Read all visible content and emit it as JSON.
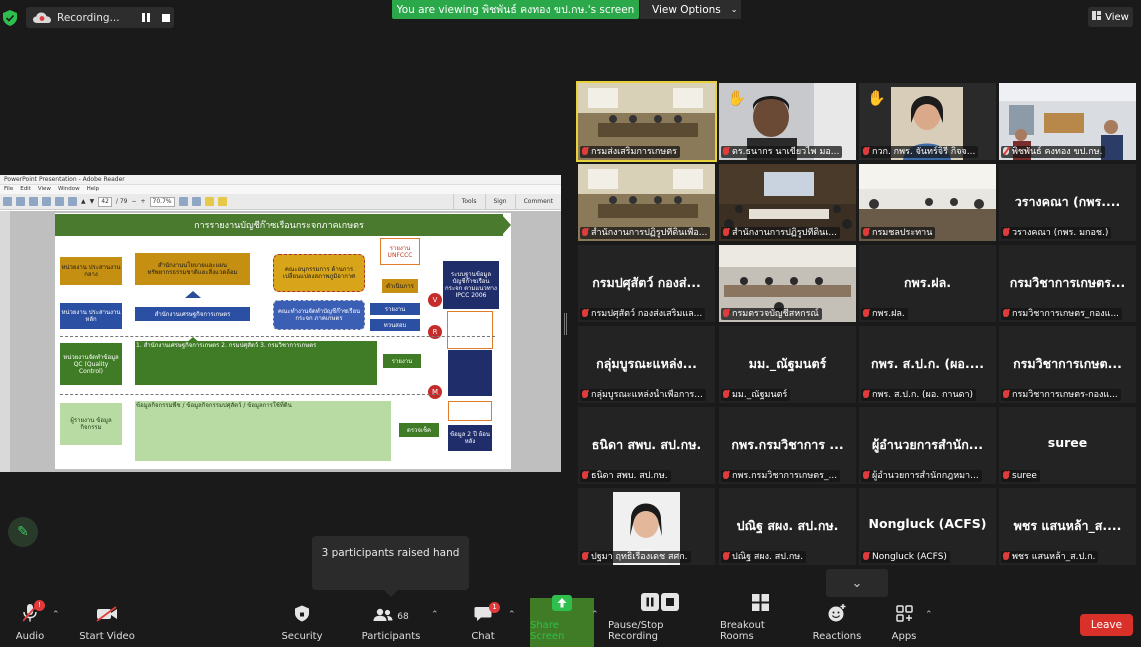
{
  "top": {
    "recording_label": "Recording...",
    "viewing_label": "You are viewing พิชพันธ์ คงทอง ขป.กษ.'s screen",
    "view_options_label": "View Options",
    "view_label": "View"
  },
  "share": {
    "window_title": "PowerPoint Presentation - Adobe Reader",
    "menu": [
      "File",
      "Edit",
      "View",
      "Window",
      "Help"
    ],
    "page_field": "42",
    "page_total": "/ 79",
    "zoom": "70.7%",
    "tools_label": "Tools",
    "sign_label": "Sign",
    "comment_label": "Comment",
    "slide": {
      "title": "การรายงานบัญชีก๊าซเรือนกระจกภาคเกษตร",
      "box_agency": "หน่วยงาน\nประสานงานกลาง",
      "box_oae": "สำนักงานนโยบายและแผน\nทรัพยากรธรรมชาติและสิ่งแวดล้อม",
      "box_subcommittee": "คณะอนุกรรมการ\nด้านการเปลี่ยนแปลงสภาพภูมิอากาศ",
      "box_unfccc_report": "รายงาน\nUNFCCC",
      "box_process": "ดำเนินการ",
      "box_ipcc": "ระบบฐานข้อมูล\nบัญชีก๊าซเรือนกระจก\nตามแนวทาง\nIPCC 2006",
      "box_sector_agency": "หน่วยงาน\nประสานงานหลัก",
      "box_oae2": "สำนักงานเศรษฐกิจการเกษตร",
      "box_workgroup": "คณะทำงานจัดทำบัญชีก๊าซเรือนกระจก\nภาคเกษตร",
      "box_report": "รายงาน",
      "box_review": "ทวนสอบ",
      "box_qc": "หน่วยงานจัดทำข้อมูล\nQC\n(Quality Control)",
      "box_green_main": "1. สำนักงานเศรษฐกิจการเกษตร   2. กรมปศุสัตว์   3. กรมวิชาการเกษตร",
      "box_report2": "รายงาน",
      "box_reporter": "ผู้รายงาน\nข้อมูลกิจกรรม",
      "box_activity": "ข้อมูลกิจกรรมพืช / ข้อมูลกิจกรรมปศุสัตว์ / ข้อมูลการใช้ที่ดิน",
      "box_checked": "ตรวจเช็ค",
      "box_data2y": "ข้อมูล 2 ปี\nย้อนหลัง",
      "badge_v": "V",
      "badge_r": "R",
      "badge_m": "M"
    }
  },
  "tiles": [
    {
      "name": "",
      "label": "กรมส่งเสริมการเกษตร",
      "hand": false,
      "active": true,
      "photo": "room"
    },
    {
      "name": "",
      "label": "ดร.ธนากร นาเขียวไพ มอ...",
      "hand": true,
      "active": false,
      "photo": "person"
    },
    {
      "name": "",
      "label": "กวก. กพร. จันทร์จิรี กิจจ...",
      "hand": true,
      "active": false,
      "photo": "woman"
    },
    {
      "name": "",
      "label": "พิชพันธ์ คงทอง ขป.กษ.",
      "hand": false,
      "active": false,
      "photo": "office"
    },
    {
      "name": "",
      "label": "สำนักงานการปฏิรูปที่ดินเพื่อ...",
      "hand": false,
      "active": false,
      "photo": "room"
    },
    {
      "name": "",
      "label": "สำนักงานการปฏิรูปที่ดินเ...",
      "hand": false,
      "active": false,
      "photo": "hall"
    },
    {
      "name": "",
      "label": "กรมชลประทาน",
      "hand": false,
      "active": false,
      "photo": "meeting"
    },
    {
      "name": "วรางคณา (กพร....",
      "label": "วรางคณา (กพร. มกอช.)",
      "hand": false,
      "active": false,
      "photo": ""
    },
    {
      "name": "กรมปศุสัตว์ กองส่...",
      "label": "กรมปศุสัตว์ กองส่งเสริมแล...",
      "hand": false,
      "active": false,
      "photo": ""
    },
    {
      "name": "",
      "label": "กรมตรวจบัญชีสหกรณ์",
      "hand": false,
      "active": false,
      "photo": "room2"
    },
    {
      "name": "กพร.ฝล.",
      "label": "กพร.ฝล.",
      "hand": false,
      "active": false,
      "photo": ""
    },
    {
      "name": "กรมวิชาการเกษตร...",
      "label": "กรมวิชาการเกษตร_กองแ...",
      "hand": false,
      "active": false,
      "photo": ""
    },
    {
      "name": "กลุ่มบูรณะแหล่ง...",
      "label": "กลุ่มบูรณะแหล่งน้ำเพื่อการ...",
      "hand": false,
      "active": false,
      "photo": ""
    },
    {
      "name": "มม._ณัฐมนตร์",
      "label": "มม._ณัฐมนตร์",
      "hand": false,
      "active": false,
      "photo": ""
    },
    {
      "name": "กพร. ส.ป.ก. (ผอ....",
      "label": "กพร. ส.ป.ก. (ผอ. กานดา)",
      "hand": false,
      "active": false,
      "photo": ""
    },
    {
      "name": "กรมวิชาการเกษต...",
      "label": "กรมวิชาการเกษตร-กองแ...",
      "hand": false,
      "active": false,
      "photo": ""
    },
    {
      "name": "ธนิดา สพบ. สป.กษ.",
      "label": "ธนิดา สพบ. สป.กษ.",
      "hand": false,
      "active": false,
      "photo": ""
    },
    {
      "name": "กพร.กรมวิชาการ ...",
      "label": "กพร.กรมวิชาการเกษตร_...",
      "hand": false,
      "active": false,
      "photo": ""
    },
    {
      "name": "ผู้อำนวยการสำนัก...",
      "label": "ผู้อำนวยการสำนักกฎหมา...",
      "hand": false,
      "active": false,
      "photo": ""
    },
    {
      "name": "suree",
      "label": "suree",
      "hand": false,
      "active": false,
      "photo": ""
    },
    {
      "name": "",
      "label": "ปฐมา ฤทธิเรืองเดช สศก.",
      "hand": false,
      "active": false,
      "photo": "portrait"
    },
    {
      "name": "ปณิฐ สผง. สป.กษ.",
      "label": "ปณิฐ สผง. สป.กษ.",
      "hand": false,
      "active": false,
      "photo": ""
    },
    {
      "name": "Nongluck (ACFS)",
      "label": "Nongluck (ACFS)",
      "hand": false,
      "active": false,
      "photo": ""
    },
    {
      "name": "พชร แสนหล้า_ส....",
      "label": "พชร แสนหล้า_ส.ป.ก.",
      "hand": false,
      "active": false,
      "photo": ""
    }
  ],
  "toast": "3 participants raised hand",
  "toolbar": {
    "audio": "Audio",
    "audio_badge": "!",
    "start_video": "Start Video",
    "security": "Security",
    "participants": "Participants",
    "participants_count": "68",
    "chat": "Chat",
    "chat_badge": "1",
    "share_screen": "Share Screen",
    "pause_stop": "Pause/Stop Recording",
    "breakout": "Breakout Rooms",
    "reactions": "Reactions",
    "apps": "Apps",
    "leave": "Leave"
  },
  "colors": {
    "viewing_bar": "#2aa84a",
    "leave": "#d9312a",
    "active_speaker": "#e8d23b",
    "share_green": "#2fbf4f"
  }
}
